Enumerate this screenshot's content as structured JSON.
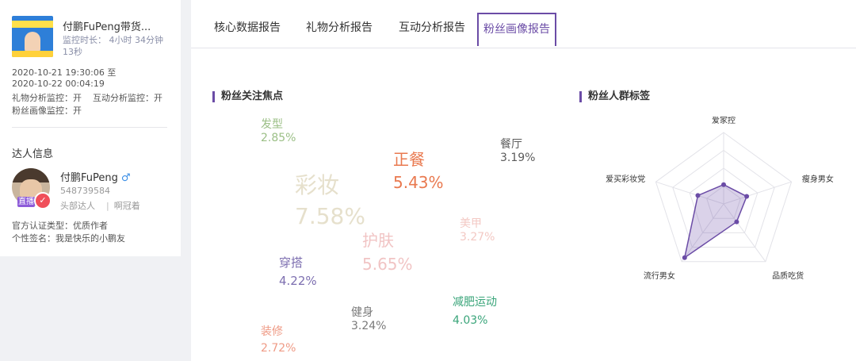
{
  "sidebar": {
    "live": {
      "title": "付鹏FuPeng带货...",
      "monitor_line1": "监控时长： 4小时 34分钟",
      "monitor_line2": "13秒"
    },
    "date_range_start": "2020-10-21 19:30:06 至",
    "date_range_end": "2020-10-22 00:04:19",
    "monitor_flags_line1": "礼物分析监控：开    互动分析监控：开",
    "monitor_flags_line2": "粉丝画像监控：开",
    "section_title": "达人信息",
    "kol": {
      "name": "付鹏FuPeng",
      "gender_icon": "male-icon",
      "id": "548739584",
      "type_tag": "头部达人",
      "extra_tag": "啊冠着",
      "live_badge": "直播",
      "certification": "官方认证类型：优质作者",
      "signature": "个性签名：我是快乐的小鹏友"
    }
  },
  "tabs": [
    {
      "label": "核心数据报告",
      "active": false
    },
    {
      "label": "礼物分析报告",
      "active": false
    },
    {
      "label": "互动分析报告",
      "active": false
    },
    {
      "label": "粉丝画像报告",
      "active": true
    }
  ],
  "focus_panel": {
    "title": "粉丝关注焦点",
    "words": [
      {
        "name": "发型",
        "value": "2.85%",
        "color": "#9bbf86"
      },
      {
        "name": "餐厅",
        "value": "3.19%",
        "color": "#5b5b5b"
      },
      {
        "name": "正餐",
        "value": "5.43%",
        "color": "#e9794f"
      },
      {
        "name": "彩妆",
        "value": "7.58%",
        "color": "#e6e0cc"
      },
      {
        "name": "美甲",
        "value": "3.27%",
        "color": "#f3c9c4"
      },
      {
        "name": "护肤",
        "value": "5.65%",
        "color": "#f1c4c4"
      },
      {
        "name": "穿搭",
        "value": "4.22%",
        "color": "#7d6fb0"
      },
      {
        "name": "健身",
        "value": "3.24%",
        "color": "#7a7a7a"
      },
      {
        "name": "减肥运动",
        "value": "4.03%",
        "color": "#3aa57a"
      },
      {
        "name": "装修",
        "value": "2.72%",
        "color": "#ef9b86"
      }
    ]
  },
  "tags_panel": {
    "title": "粉丝人群标签"
  },
  "chart_data": {
    "type": "radar",
    "categories": [
      "爱家控",
      "瘦身男女",
      "品质吃货",
      "流行男女",
      "爱买彩妆党"
    ],
    "values": [
      0.27,
      0.34,
      0.31,
      0.93,
      0.38
    ],
    "max": 1,
    "levels": 4,
    "series_color": "#6b4ca6"
  }
}
